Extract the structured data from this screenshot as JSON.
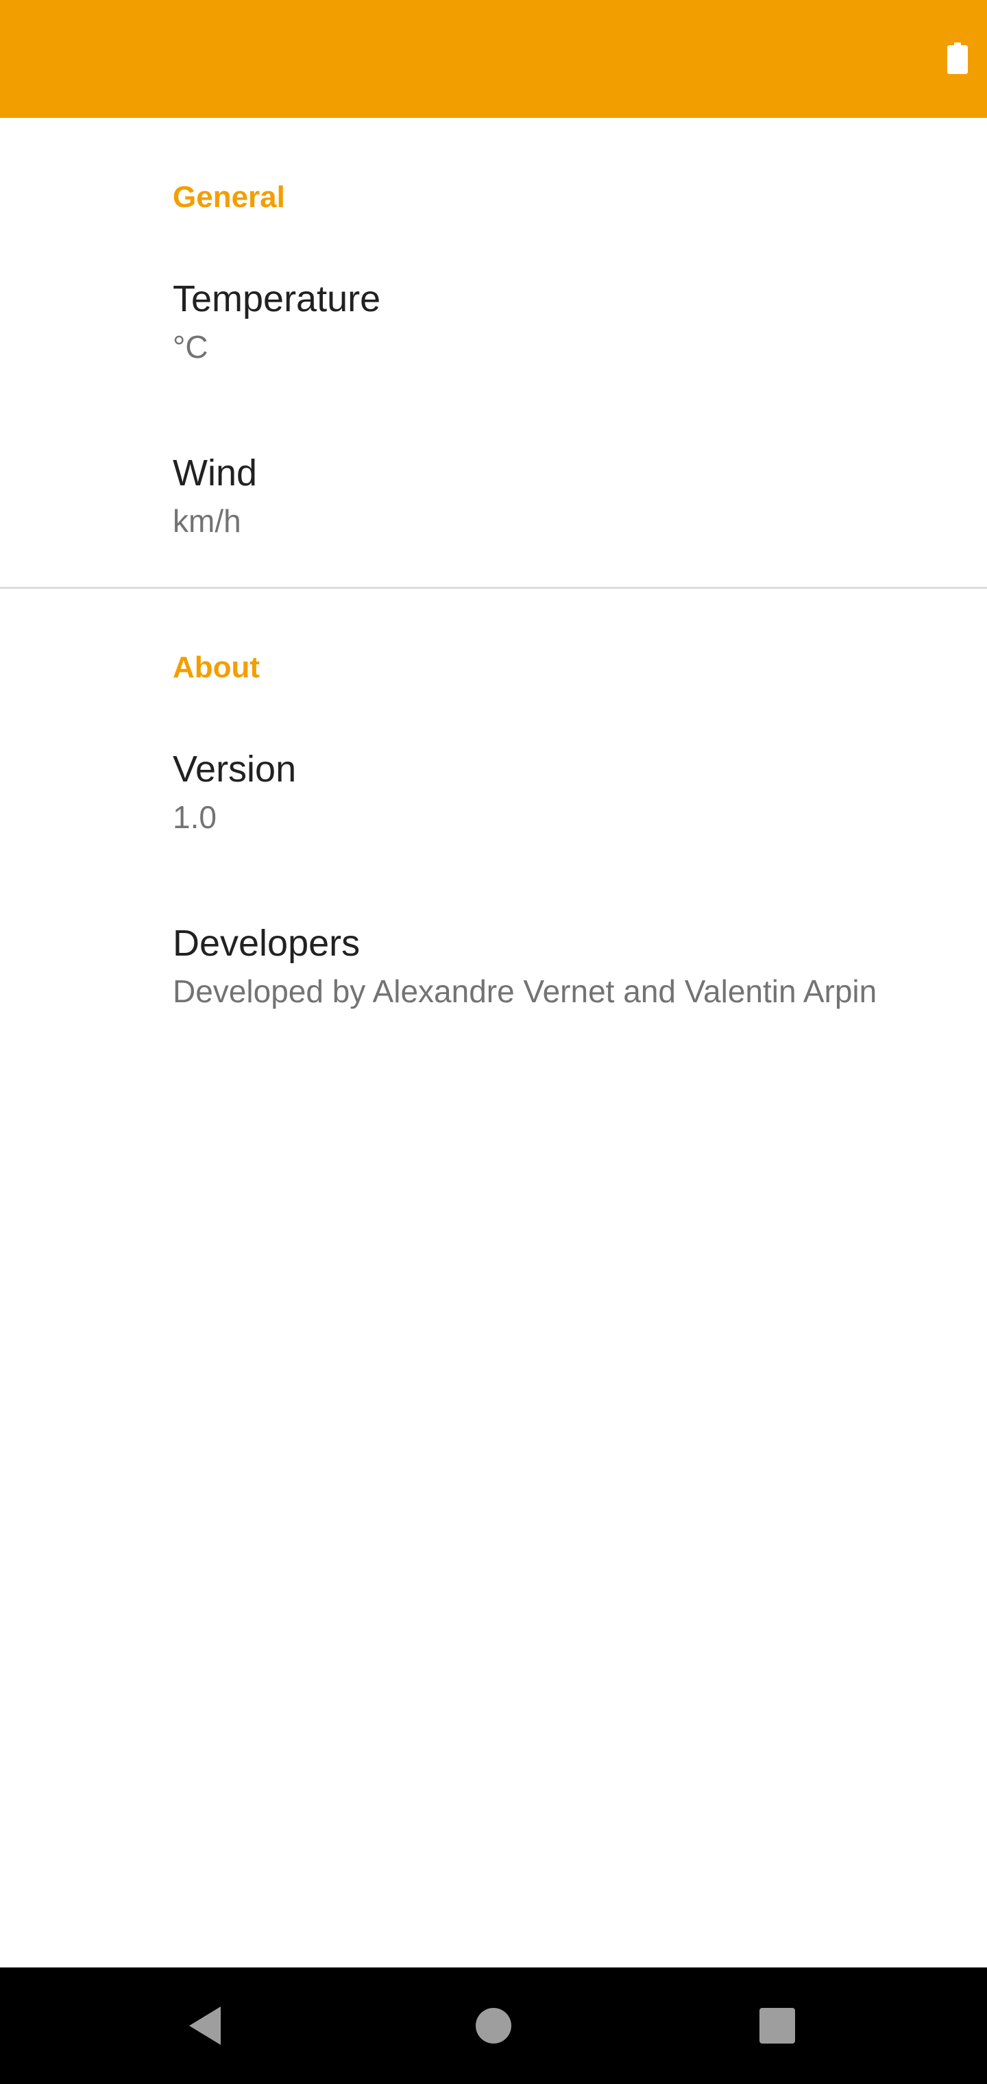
{
  "theme": {
    "accent": "#f39e00",
    "status_bar_color": "#f39e00",
    "section_header_color": "#f39e00",
    "title_color": "#212121",
    "summary_color": "#737373",
    "nav_bar_color": "#000000"
  },
  "status_bar": {
    "icons": [
      "battery-icon"
    ]
  },
  "sections": [
    {
      "header": "General",
      "items": [
        {
          "title": "Temperature",
          "summary": "°C"
        },
        {
          "title": "Wind",
          "summary": "km/h"
        }
      ]
    },
    {
      "header": "About",
      "items": [
        {
          "title": "Version",
          "summary": "1.0"
        },
        {
          "title": "Developers",
          "summary": "Developed by Alexandre Vernet and Valentin Arpin"
        }
      ]
    }
  ],
  "nav_bar": {
    "buttons": [
      "back-icon",
      "home-icon",
      "recents-icon"
    ]
  }
}
